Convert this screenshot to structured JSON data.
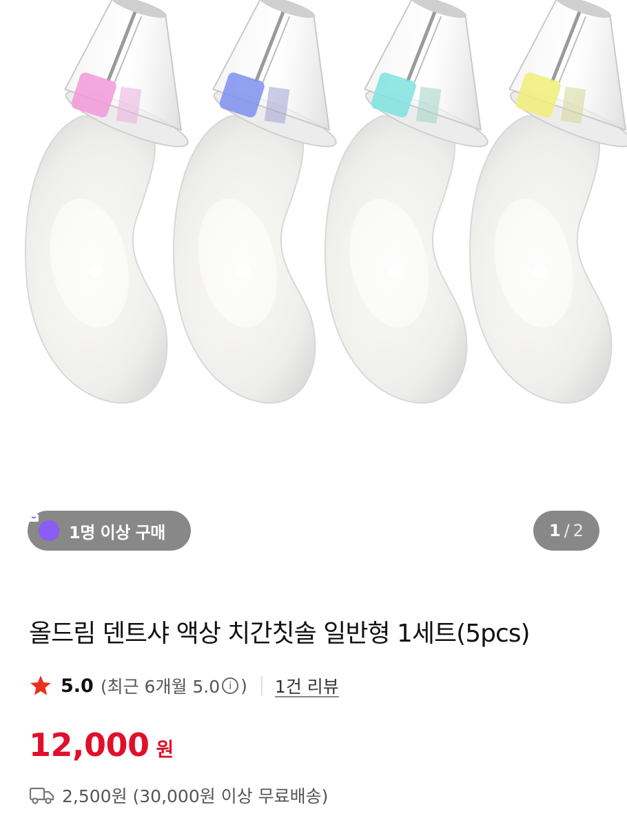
{
  "hero": {
    "badge_label": "1명 이상 구매",
    "pager": {
      "current": "1",
      "separator": "/",
      "total": "2"
    },
    "brush_colors": [
      "#f29ad8",
      "#7f8ff0",
      "#7fe3e0",
      "#f0ee78"
    ]
  },
  "product": {
    "title": "올드림 덴트샤 액상 치간칫솔 일반형 1세트(5pcs)",
    "rating": {
      "score": "5.0",
      "recent_open": "(최근 6개월 5.0",
      "recent_close": ")",
      "review_link": "1건 리뷰"
    },
    "price": "12,000",
    "currency": "원",
    "shipping": "2,500원 (30,000원 이상 무료배송)"
  },
  "colors": {
    "price_red": "#e0102b",
    "badge_purple": "#8b5cf6",
    "star_red": "#e8321e"
  }
}
